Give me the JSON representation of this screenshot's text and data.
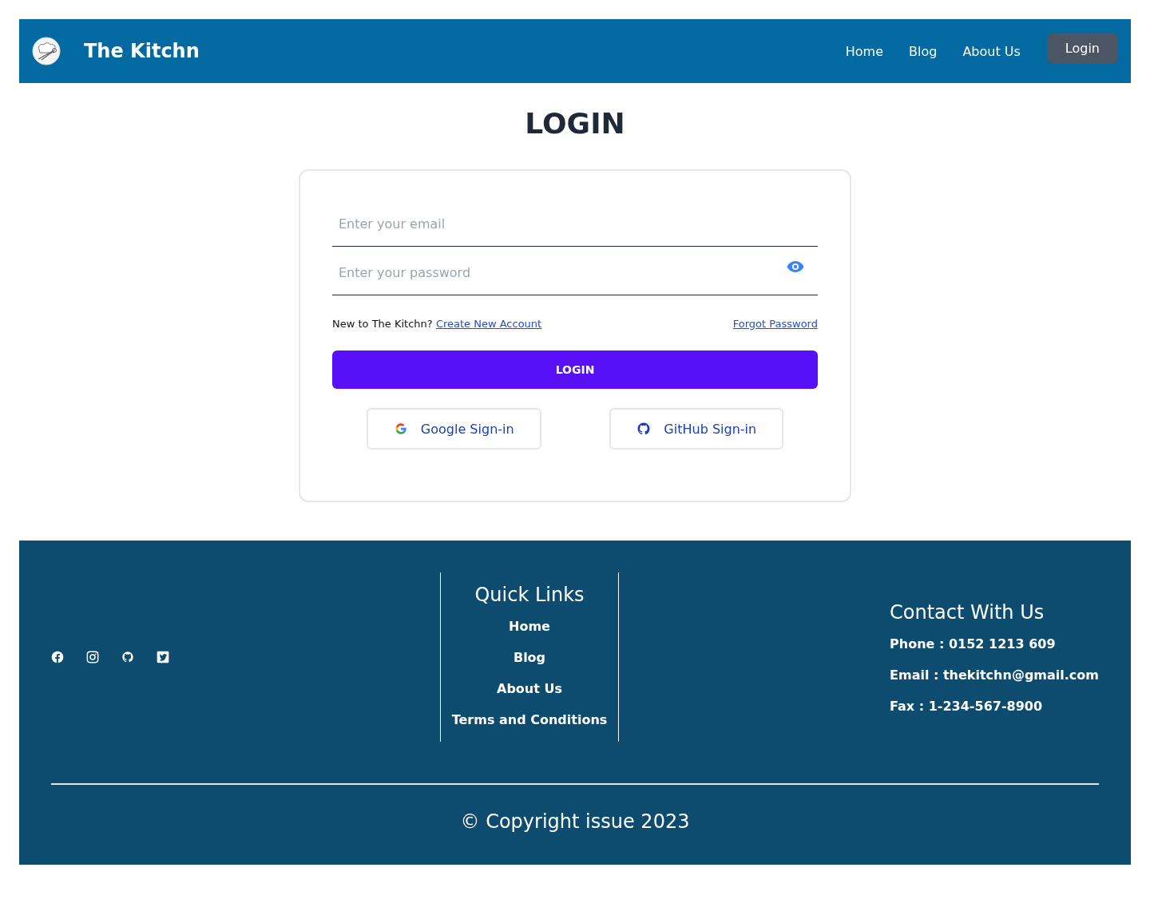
{
  "header": {
    "brand": "The Kitchn",
    "nav": [
      "Home",
      "Blog",
      "About Us"
    ],
    "login_button": "Login"
  },
  "title": "LOGIN",
  "form": {
    "email": {
      "placeholder": "Enter your email"
    },
    "password": {
      "placeholder": "Enter your password"
    },
    "signup_prompt": "New to The Kitchn?",
    "signup_link": "Create New Account",
    "forgot_link": "Forgot Password",
    "submit": "LOGIN",
    "providers": [
      {
        "kind": "google",
        "label": "Google Sign-in"
      },
      {
        "kind": "github",
        "label": "GitHub Sign-in"
      }
    ]
  },
  "footer": {
    "social": [
      {
        "kind": "facebook"
      },
      {
        "kind": "instagram"
      },
      {
        "kind": "github"
      },
      {
        "kind": "twitter"
      }
    ],
    "quick_links": {
      "heading": "Quick Links",
      "links": [
        "Home",
        "Blog",
        "About Us",
        "Terms and Conditions"
      ]
    },
    "contact": {
      "heading": "Contact With Us",
      "lines": [
        "Phone : 0152 1213 609",
        "Email : thekitchn@gmail.com",
        "Fax : 1-234-567-8900"
      ]
    },
    "copyright": "© Copyright issue 2023"
  }
}
